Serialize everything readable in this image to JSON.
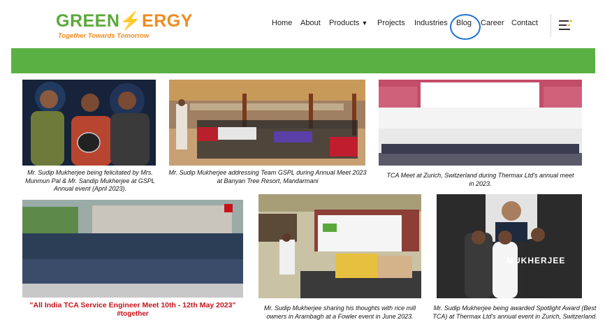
{
  "brand": {
    "logo_green": "GREEN",
    "logo_orange": "ERGY",
    "tagline": "Together Towards Tomorrow",
    "green": "#5aa83a",
    "orange": "#f08a1e"
  },
  "nav": {
    "home": "Home",
    "about": "About",
    "products": "Products",
    "products_caret": "▼",
    "projects": "Projects",
    "industries": "Industries",
    "blog": "Blog",
    "career": "Career",
    "contact": "Contact",
    "menu_icon": "hamburger-menu-icon",
    "highlight_color": "#1e73d6"
  },
  "band_color": "#5ab043",
  "gallery": {
    "captions": [
      "Mr. Sudip Mukherjee being felicitated by Mrs. Munmun Pal & Mr. Sandip Mukherjee at GSPL Annual event (April 2023).",
      "Mr. Sudip Mukherjee addressing Team GSPL during Annual Meet 2023 at Banyan Tree Resort, Mandarmani",
      "TCA Meet at Zurich, Switzerland during Thermax Ltd's annual meet in 2023.",
      "Mr. Sudip Mukherjee sharing his thoughts with rice mill owners in Arambagh at a Fowler event in June 2023.",
      "Mr. Sudip Mukherjee being awarded Spotlight Award (Best TCA) at Thermax Ltd's annual event in Zurich, Switzerland."
    ],
    "banner_line1": "\"All India TCA Service Engineer Meet 10th - 12th May 2023\"",
    "banner_line2": "#together",
    "backdrop_text": "MUKHERJEE"
  }
}
